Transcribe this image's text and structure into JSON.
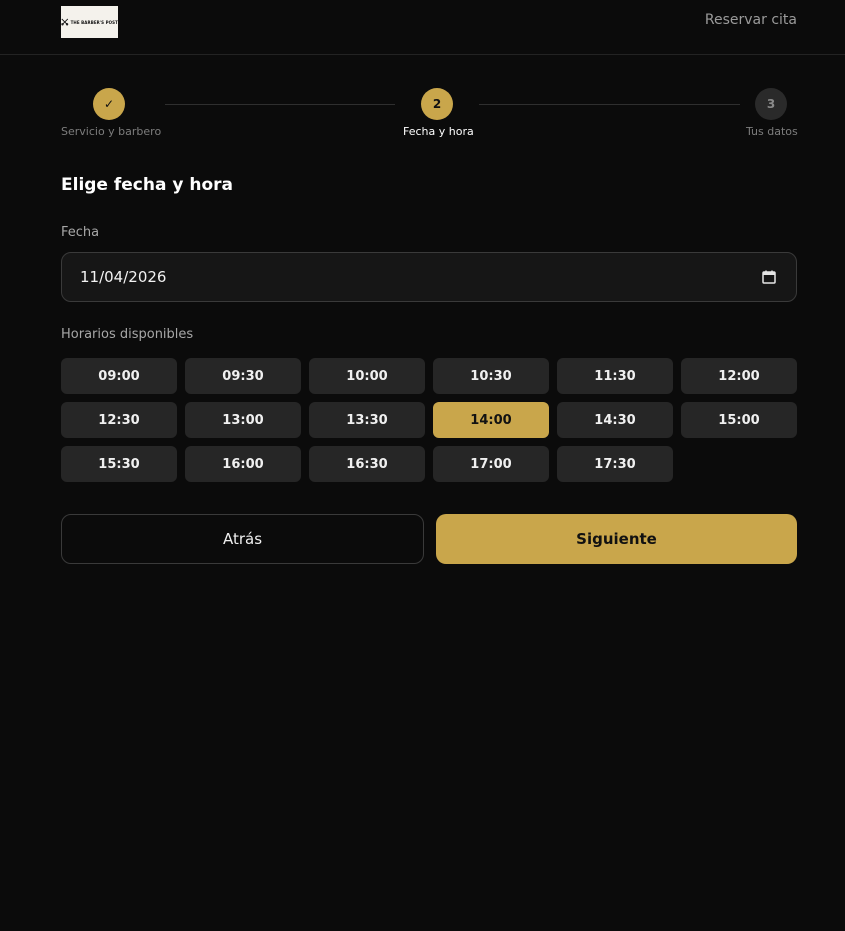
{
  "header": {
    "logo_text": "THE BARBER'S POST",
    "reserve_link": "Reservar cita"
  },
  "stepper": {
    "steps": [
      {
        "number": "✓",
        "label": "Servicio y barbero",
        "state": "done"
      },
      {
        "number": "2",
        "label": "Fecha y hora",
        "state": "active"
      },
      {
        "number": "3",
        "label": "Tus datos",
        "state": "todo"
      }
    ]
  },
  "main": {
    "title": "Elige fecha y hora",
    "date_label": "Fecha",
    "date_value": "11/04/2026",
    "slots_label": "Horarios disponibles",
    "slots": [
      "09:00",
      "09:30",
      "10:00",
      "10:30",
      "11:30",
      "12:00",
      "12:30",
      "13:00",
      "13:30",
      "14:00",
      "14:30",
      "15:00",
      "15:30",
      "16:00",
      "16:30",
      "17:00",
      "17:30"
    ],
    "selected_slot": "14:00"
  },
  "actions": {
    "back_label": "Atrás",
    "next_label": "Siguiente"
  },
  "colors": {
    "accent": "#c9a64b",
    "background": "#0b0b0b",
    "slot_bg": "#262626"
  }
}
